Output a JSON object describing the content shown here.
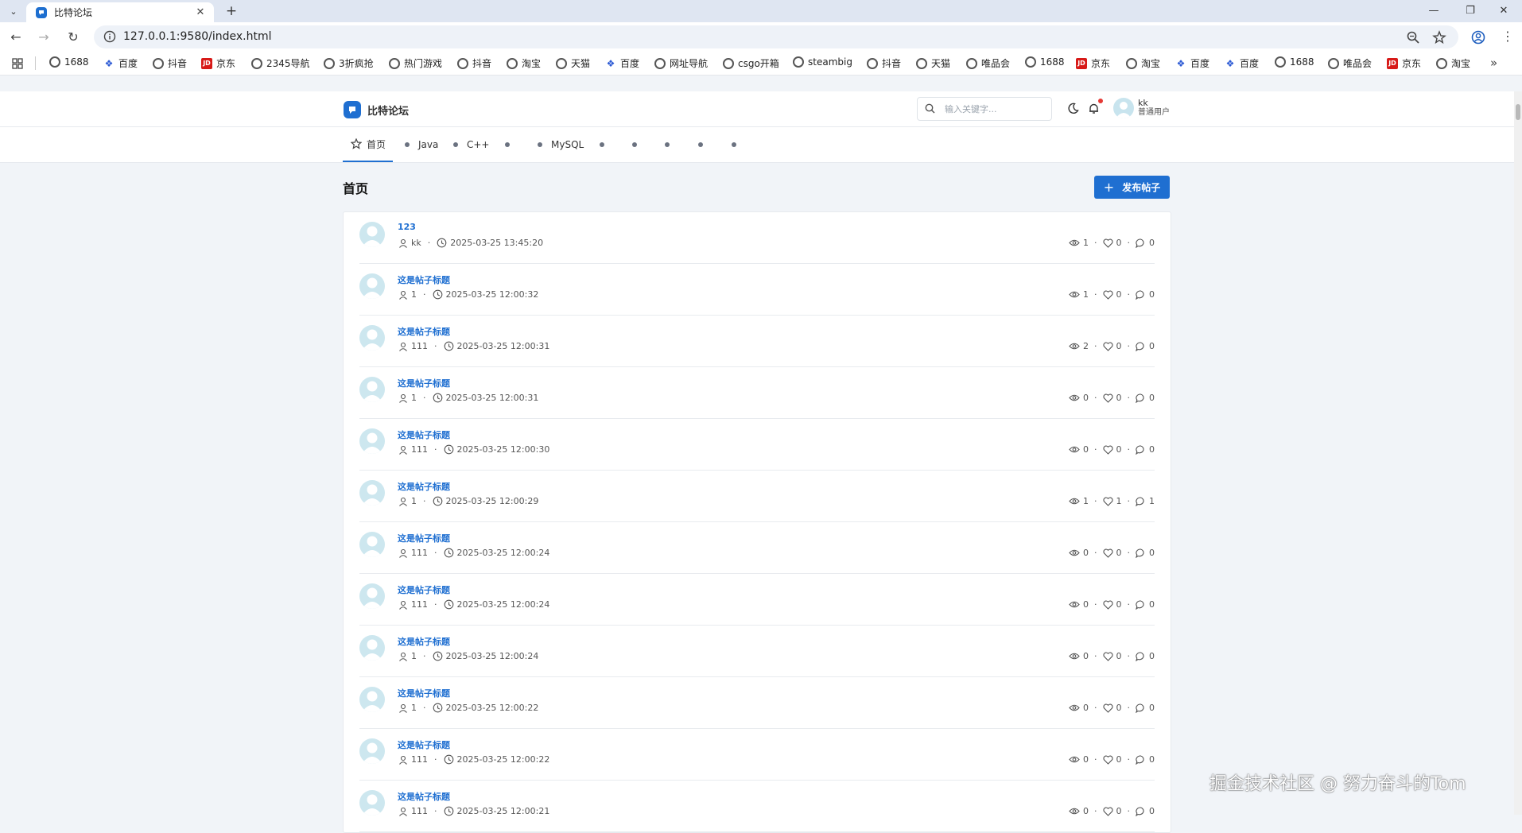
{
  "browser": {
    "tab_title": "比特论坛",
    "url": "127.0.0.1:9580/index.html",
    "bookmarks": [
      "1688",
      "百度",
      "抖音",
      "京东",
      "2345导航",
      "3折疯抢",
      "热门游戏",
      "抖音",
      "淘宝",
      "天猫",
      "百度",
      "网址导航",
      "csgo开箱",
      "steambig",
      "抖音",
      "天猫",
      "唯品会",
      "1688",
      "京东",
      "淘宝",
      "百度",
      "百度",
      "1688",
      "唯品会",
      "京东",
      "淘宝"
    ]
  },
  "header": {
    "site_name": "比特论坛",
    "search_placeholder": "输入关键字...",
    "username": "kk",
    "user_role": "普通用户"
  },
  "nav": {
    "items": [
      {
        "label": "首页"
      },
      {
        "label": "Java"
      },
      {
        "label": "C++"
      },
      {
        "label": ""
      },
      {
        "label": "MySQL"
      },
      {
        "label": ""
      },
      {
        "label": ""
      },
      {
        "label": ""
      },
      {
        "label": ""
      },
      {
        "label": ""
      }
    ]
  },
  "main": {
    "page_title": "首页",
    "publish_label": "发布帖子"
  },
  "posts": [
    {
      "title": "123",
      "author": "kk",
      "time": "2025-03-25 13:45:20",
      "views": "1",
      "likes": "0",
      "comments": "0"
    },
    {
      "title": "这是帖子标题",
      "author": "1",
      "time": "2025-03-25 12:00:32",
      "views": "1",
      "likes": "0",
      "comments": "0"
    },
    {
      "title": "这是帖子标题",
      "author": "111",
      "time": "2025-03-25 12:00:31",
      "views": "2",
      "likes": "0",
      "comments": "0"
    },
    {
      "title": "这是帖子标题",
      "author": "1",
      "time": "2025-03-25 12:00:31",
      "views": "0",
      "likes": "0",
      "comments": "0"
    },
    {
      "title": "这是帖子标题",
      "author": "111",
      "time": "2025-03-25 12:00:30",
      "views": "0",
      "likes": "0",
      "comments": "0"
    },
    {
      "title": "这是帖子标题",
      "author": "1",
      "time": "2025-03-25 12:00:29",
      "views": "1",
      "likes": "1",
      "comments": "1"
    },
    {
      "title": "这是帖子标题",
      "author": "111",
      "time": "2025-03-25 12:00:24",
      "views": "0",
      "likes": "0",
      "comments": "0"
    },
    {
      "title": "这是帖子标题",
      "author": "111",
      "time": "2025-03-25 12:00:24",
      "views": "0",
      "likes": "0",
      "comments": "0"
    },
    {
      "title": "这是帖子标题",
      "author": "1",
      "time": "2025-03-25 12:00:24",
      "views": "0",
      "likes": "0",
      "comments": "0"
    },
    {
      "title": "这是帖子标题",
      "author": "1",
      "time": "2025-03-25 12:00:22",
      "views": "0",
      "likes": "0",
      "comments": "0"
    },
    {
      "title": "这是帖子标题",
      "author": "111",
      "time": "2025-03-25 12:00:22",
      "views": "0",
      "likes": "0",
      "comments": "0"
    },
    {
      "title": "这是帖子标题",
      "author": "111",
      "time": "2025-03-25 12:00:21",
      "views": "0",
      "likes": "0",
      "comments": "0"
    }
  ],
  "watermark": "掘金技术社区 @ 努力奋斗的Tom",
  "colors": {
    "accent": "#1f6fd1",
    "page_bg": "#f1f4f8"
  }
}
